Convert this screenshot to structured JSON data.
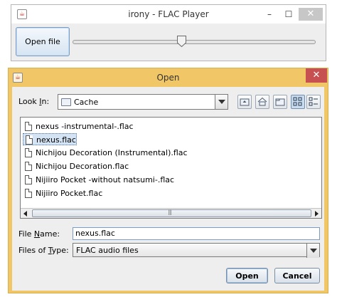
{
  "player": {
    "title": "irony - FLAC Player",
    "open_file_label": "Open file",
    "seek_position": 0.45
  },
  "dialog": {
    "title": "Open",
    "look_in_label_pre": "Look ",
    "look_in_label_key": "I",
    "look_in_label_post": "n:",
    "look_in_value": "Cache",
    "files": [
      "nexus -instrumental-.flac",
      "nexus.flac",
      "Nichijou Decoration (Instrumental).flac",
      "Nichijou Decoration.flac",
      "Nijiiro Pocket -without natsumi-.flac",
      "Nijiiro Pocket.flac"
    ],
    "selected_index": 1,
    "file_name_label_pre": "File ",
    "file_name_label_key": "N",
    "file_name_label_post": "ame:",
    "file_name_value": "nexus.flac",
    "files_of_type_label_pre": "Files of ",
    "files_of_type_label_key": "T",
    "files_of_type_label_post": "ype:",
    "files_of_type_value": "FLAC audio files",
    "open_label": "Open",
    "cancel_label": "Cancel"
  },
  "icons": {
    "app": "java-cup-icon",
    "folder": "folder-icon",
    "file": "file-icon"
  },
  "colors": {
    "dialog_frame": "#f0c666",
    "close_button": "#c75050",
    "selection": "#d5e4f4"
  }
}
